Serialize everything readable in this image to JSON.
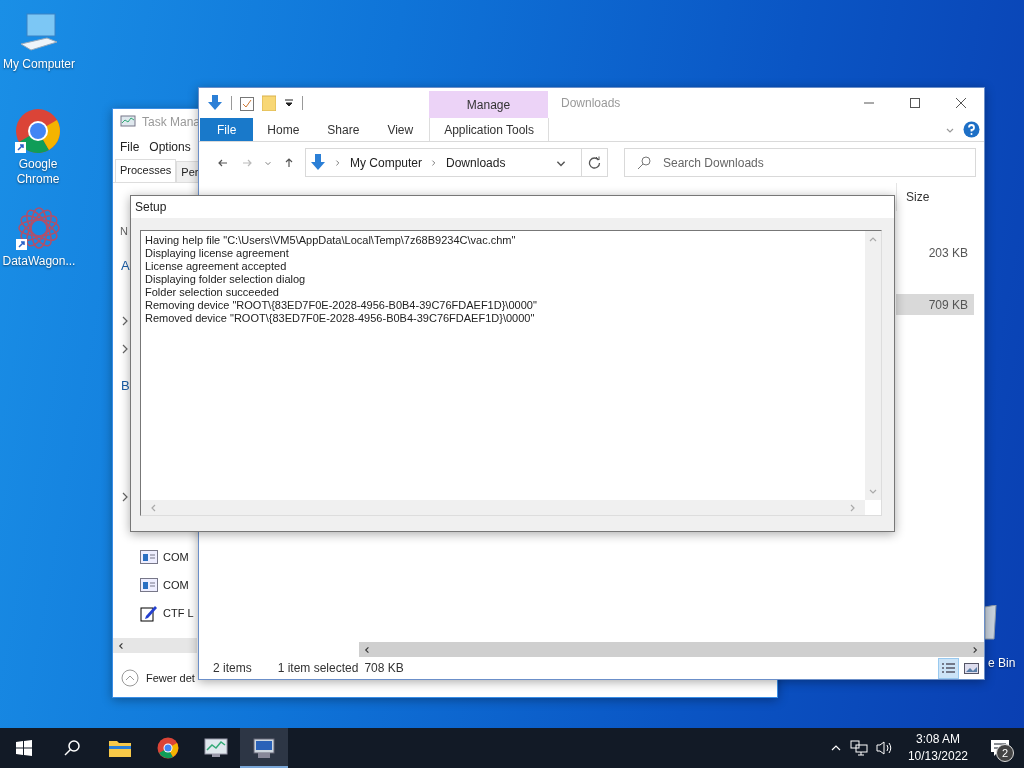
{
  "desktop_icons": [
    {
      "kind": "computer",
      "label": "My Computer"
    },
    {
      "kind": "chrome",
      "label": "Google Chrome"
    },
    {
      "kind": "mandala",
      "label": "DataWagon..."
    },
    {
      "kind": "recycle",
      "label": "e Bin"
    }
  ],
  "task_manager": {
    "title": "Task Mana",
    "menu": [
      "File",
      "Options"
    ],
    "tabs": [
      {
        "label": "Processes",
        "selected": true
      },
      {
        "label": "Per",
        "selected": false
      }
    ],
    "column_1": "N",
    "tree": [
      {
        "kind": "group",
        "label": "A"
      },
      {
        "kind": "row"
      },
      {
        "kind": "expander"
      },
      {
        "kind": "expander"
      },
      {
        "kind": "group",
        "label": "B"
      },
      {
        "kind": "row"
      },
      {
        "kind": "row"
      },
      {
        "kind": "row"
      },
      {
        "kind": "expander"
      }
    ],
    "processes": [
      {
        "kind": "service",
        "name": "COM"
      },
      {
        "kind": "service",
        "name": "COM"
      },
      {
        "kind": "pen",
        "name": "CTF L"
      }
    ],
    "footer": "Fewer det"
  },
  "explorer": {
    "title": "Downloads",
    "context_header": "Manage",
    "ribbon_tabs": [
      {
        "label": "File",
        "selected": true
      },
      {
        "label": "Home",
        "selected": false
      },
      {
        "label": "Share",
        "selected": false
      },
      {
        "label": "View",
        "selected": false
      },
      {
        "label": "Application Tools",
        "selected": false
      }
    ],
    "address": [
      "My Computer",
      "Downloads"
    ],
    "search": {
      "placeholder": "Search Downloads"
    },
    "columns": [
      "Size"
    ],
    "rows": [
      {
        "size": "203 KB",
        "selected": false
      },
      {
        "size": "709 KB",
        "selected": true
      }
    ],
    "status": {
      "count": "2 items",
      "selection": "1 item selected",
      "selection_size": "708 KB"
    },
    "view_buttons": [
      {
        "kind": "details",
        "selected": true
      },
      {
        "kind": "large-icons",
        "selected": false
      }
    ]
  },
  "setup": {
    "title": "Setup",
    "log": [
      "Having help file \"C:\\Users\\VM5\\AppData\\Local\\Temp\\7z68B9234C\\vac.chm\"",
      "Displaying license agreement",
      "License agreement accepted",
      "Displaying folder selection dialog",
      "Folder selection succeeded",
      "Removing device \"ROOT\\{83ED7F0E-2028-4956-B0B4-39C76FDAEF1D}\\0000\"",
      "Removed device \"ROOT\\{83ED7F0E-2028-4956-B0B4-39C76FDAEF1D}\\0000\""
    ]
  },
  "taskbar": {
    "apps": [
      {
        "kind": "start",
        "active": false
      },
      {
        "kind": "search",
        "active": false
      },
      {
        "kind": "explorer",
        "active": false
      },
      {
        "kind": "chrome",
        "active": false
      },
      {
        "kind": "taskmgr",
        "active": false
      },
      {
        "kind": "setup",
        "active": true
      }
    ],
    "time": "3:08 AM",
    "date": "10/13/2022",
    "notifications": "2"
  }
}
